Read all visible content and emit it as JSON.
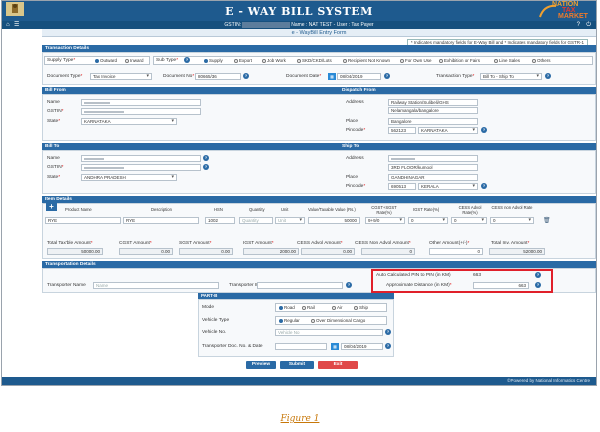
{
  "header": {
    "title": "E - WAY BILL SYSTEM",
    "logo_line1": "NATION",
    "logo_line2": "TAX",
    "logo_line3": "MARKET",
    "gstin_prefix": "GSTIN:",
    "gstin_suffix": "Name : NAT TEST - User : Tax Payer"
  },
  "subtitle": "e - WayBill Entry Form",
  "note": "* Indicates mandatory fields for E-Way Bill and * Indicates mandatory fields for GSTR-1",
  "transaction": {
    "section_title": "Transaction Details",
    "supply_type_label": "Supply Type",
    "supply_type_options": [
      "Outward",
      "Inward"
    ],
    "sub_type_label": "Sub Type",
    "sub_type_options": [
      "Supply",
      "Export",
      "Job Work",
      "SKD/CKD/Lots",
      "Recipient Not Known",
      "For Own Use",
      "Exhibition or Fairs",
      "Line Sales",
      "Others"
    ],
    "doc_type_label": "Document Type",
    "doc_type_value": "Tax Invoice",
    "doc_no_label": "Document No",
    "doc_no_value": "80665/36",
    "doc_date_label": "Document Date",
    "doc_date_value": "08/04/2019",
    "trans_type_label": "Transaction Type",
    "trans_type_value": "Bill To - Ship To"
  },
  "bill_from": {
    "section_title": "Bill From",
    "name_label": "Name",
    "gstin_label": "GSTIN",
    "state_label": "State",
    "state_value": "KARNATAKA"
  },
  "dispatch_from": {
    "section_title": "Dispatch From",
    "address_label": "Address",
    "address_line1": "Railway Station/Sulibeli/GHS",
    "address_line2": "Nelamangala/bangalore",
    "place_label": "Place",
    "place_value": "Bangalore",
    "pincode_label": "Pincode",
    "pincode_value": "562123",
    "pincode_state": "KARNATAKA"
  },
  "bill_to": {
    "section_title": "Bill To",
    "name_label": "Name",
    "gstin_label": "GSTIN",
    "state_label": "State",
    "state_value": "ANDHRA PRADESH"
  },
  "ship_to": {
    "section_title": "Ship To",
    "address_label": "Address",
    "address_line2": "3RD FLOOR/kumool",
    "place_label": "Place",
    "place_value": "GANDHINAGAR",
    "pincode_label": "Pincode",
    "pincode_value": "690513",
    "pincode_state": "KERALA"
  },
  "items": {
    "section_title": "Item Details",
    "headers": [
      "Product Name",
      "Description",
      "HSN",
      "Quantity",
      "Unit",
      "Value/Taxable Value (Rs.)",
      "CGST+SGST Rate(%)",
      "IGST Rate(%)",
      "CESS Advol Rate(%)",
      "CESS non Advol Rate"
    ],
    "row": {
      "product": "RYE",
      "description": "RYE",
      "hsn": "1002",
      "quantity": "Quantity",
      "unit": "Unit",
      "value": "50000",
      "cgst_sgst": "9+9/0",
      "igst": "0",
      "cess_advol": "0",
      "cess_nonadvol": "0"
    },
    "totals": [
      {
        "label": "Total Tax'ble Amount",
        "value": "50000.00"
      },
      {
        "label": "CGST Amount",
        "value": "0.00"
      },
      {
        "label": "SGST Amount",
        "value": "0.00"
      },
      {
        "label": "IGST Amount",
        "value": "2000.00"
      },
      {
        "label": "CESS Advol Amount",
        "value": "0.00"
      },
      {
        "label": "CESS Non Advol Amount",
        "value": "0"
      },
      {
        "label": "Other Amount(+/-)",
        "value": "0"
      },
      {
        "label": "Total Inv. Amount",
        "value": "52000.00"
      }
    ]
  },
  "transport": {
    "section_title": "Transportation Details",
    "transporter_name_label": "Transporter Name",
    "transporter_name_placeholder": "Name",
    "transporter_id_label": "Transporter ID",
    "auto_pin_label": "Auto Calculated PIN to PIN (in KM)",
    "auto_pin_value": "663",
    "distance_label": "Approximate Distance (in KM)",
    "distance_value": "663"
  },
  "part_b": {
    "section_title": "PART-B",
    "mode_label": "Mode",
    "mode_options": [
      "Road",
      "Rail",
      "Air",
      "Ship"
    ],
    "vehicle_type_label": "Vehicle Type",
    "vehicle_type_options": [
      "Regular",
      "Over Dimensional Cargo"
    ],
    "vehicle_no_label": "Vehicle No.",
    "vehicle_no_placeholder": "Vehicle No",
    "trans_doc_label": "Transporter Doc. No. & Date",
    "trans_doc_date": "08/04/2019"
  },
  "buttons": {
    "preview": "Preview",
    "submit": "Submit",
    "exit": "Exit"
  },
  "footer": "©Powered by National Informatics Centre",
  "caption": "Figure 1",
  "colors": {
    "header": "#1e5a8e",
    "section": "#2a6aa5",
    "highlight": "#e0202a",
    "preview": "#2a6aa5",
    "submit": "#2a6aa5",
    "exit": "#e04848"
  }
}
